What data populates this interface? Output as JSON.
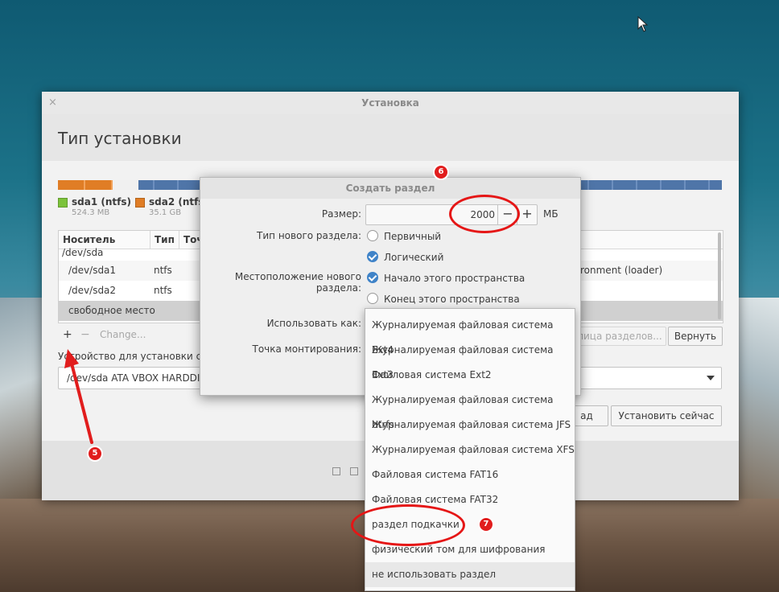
{
  "window": {
    "title": "Установка",
    "close": "×",
    "heading": "Тип установки"
  },
  "colors": {
    "ntfs1": "#7cc33a",
    "ntfs2": "#e07d25",
    "free": "#5a7fb0",
    "annotation": "#e11d1d"
  },
  "legend": [
    {
      "name": "sda1 (ntfs)",
      "size": "524.3 MB"
    },
    {
      "name": "sda2 (ntfs)",
      "size": "35.1 GB"
    }
  ],
  "table": {
    "headers": [
      "Носитель",
      "Тип",
      "Точ"
    ],
    "rows": [
      {
        "device": "/dev/sda",
        "type": "",
        "extra": ""
      },
      {
        "device": "/dev/sda1",
        "type": "ntfs",
        "extra": "ronment (loader)"
      },
      {
        "device": "/dev/sda2",
        "type": "ntfs",
        "extra": ""
      },
      {
        "device": "свободное место",
        "type": "",
        "extra": ""
      }
    ]
  },
  "toolbar": {
    "add": "+",
    "remove": "−",
    "change": "Change...",
    "partition_table": "лица разделов...",
    "revert": "Вернуть"
  },
  "device": {
    "label": "Устройство для установки систе",
    "value": "/dev/sda    ATA VBOX HARDDISK"
  },
  "buttons": {
    "back": "ад",
    "install": "Установить сейчас"
  },
  "dialog": {
    "title": "Создать раздел",
    "size_label": "Размер:",
    "size_value": "2000",
    "size_minus": "−",
    "size_plus": "+",
    "size_unit": "МБ",
    "type_label": "Тип нового раздела:",
    "type_primary": "Первичный",
    "type_logical": "Логический",
    "location_label": "Местоположение нового раздела:",
    "location_start": "Начало этого пространства",
    "location_end": "Конец этого пространства",
    "use_as_label": "Использовать как:",
    "mount_label": "Точка монтирования:"
  },
  "menu": {
    "items": [
      "Журналируемая файловая система Ext4",
      "Журналируемая файловая система Ext3",
      "Файловая система Ext2",
      "Журналируемая файловая система btrfs",
      "Журналируемая файловая система JFS",
      "Журналируемая файловая система XFS",
      "Файловая система FAT16",
      "Файловая система FAT32",
      "раздел подкачки",
      "физический том для шифрования",
      "не использовать раздел"
    ]
  },
  "annotations": {
    "step5": "5",
    "step6": "6",
    "step7": "7"
  }
}
